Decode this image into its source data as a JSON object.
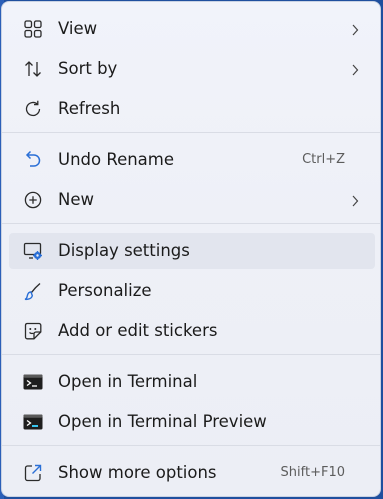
{
  "menu": {
    "items": [
      {
        "label": "View",
        "icon": "grid-icon",
        "submenu": true
      },
      {
        "label": "Sort by",
        "icon": "sort-icon",
        "submenu": true
      },
      {
        "label": "Refresh",
        "icon": "refresh-icon"
      },
      {
        "label": "Undo Rename",
        "icon": "undo-icon",
        "shortcut": "Ctrl+Z"
      },
      {
        "label": "New",
        "icon": "plus-circle-icon",
        "submenu": true
      },
      {
        "label": "Display settings",
        "icon": "display-settings-icon",
        "highlighted": true
      },
      {
        "label": "Personalize",
        "icon": "paintbrush-icon"
      },
      {
        "label": "Add or edit stickers",
        "icon": "sticker-icon"
      },
      {
        "label": "Open in Terminal",
        "icon": "terminal-icon"
      },
      {
        "label": "Open in Terminal Preview",
        "icon": "terminal-preview-icon"
      },
      {
        "label": "Show more options",
        "icon": "share-icon",
        "shortcut": "Shift+F10"
      }
    ]
  },
  "colors": {
    "background": "#1f4f9e",
    "menu_bg": "#eef0f7",
    "highlight": "#e2e5ee",
    "text": "#1b1b1b",
    "accel": "#5c5c5c",
    "accent": "#2a6fd6"
  }
}
